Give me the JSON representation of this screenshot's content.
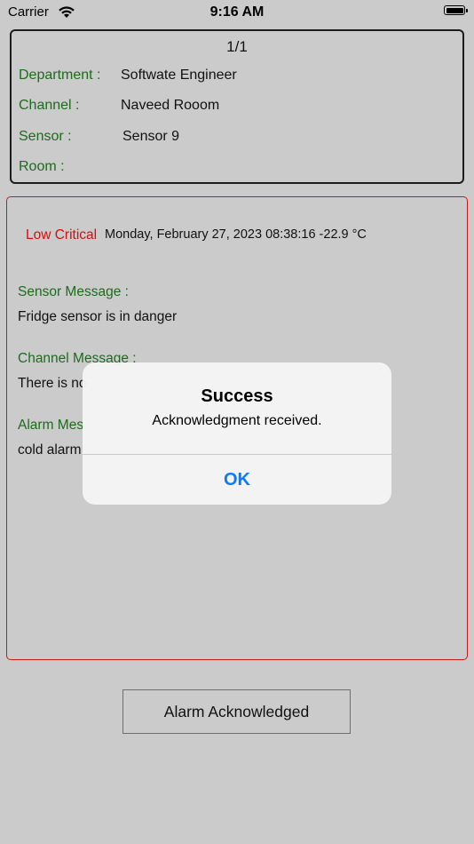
{
  "status_bar": {
    "carrier": "Carrier",
    "time": "9:16 AM",
    "wifi_icon": "wifi-icon",
    "battery_icon": "battery-icon"
  },
  "info_card": {
    "page_counter": "1/1",
    "department": {
      "label": "Department :",
      "value": "Softwate Engineer"
    },
    "channel": {
      "label": "Channel :",
      "value": "Naveed Rooom"
    },
    "sensor": {
      "label": "Sensor :",
      "value": "Sensor 9"
    },
    "room": {
      "label": "Room  :",
      "value": ""
    }
  },
  "alarm_card": {
    "severity": "Low Critical",
    "timestamp": "Monday, February 27, 2023 08:38:16  -22.9 °C",
    "sensor_message": {
      "label": "Sensor Message :",
      "text": "Fridge sensor is in danger"
    },
    "channel_message": {
      "label": "Channel Message :",
      "text": "There is no"
    },
    "alarm_message": {
      "label": "Alarm Mes",
      "text": "cold alarm"
    }
  },
  "ack_button_label": "Alarm Acknowledged",
  "alert": {
    "title": "Success",
    "message": "Acknowledgment received.",
    "ok_label": "OK"
  },
  "colors": {
    "label_green": "#1e6b1e",
    "critical_red": "#d10f0f",
    "ios_blue": "#0a7aff",
    "background": "#cbcbcb"
  }
}
